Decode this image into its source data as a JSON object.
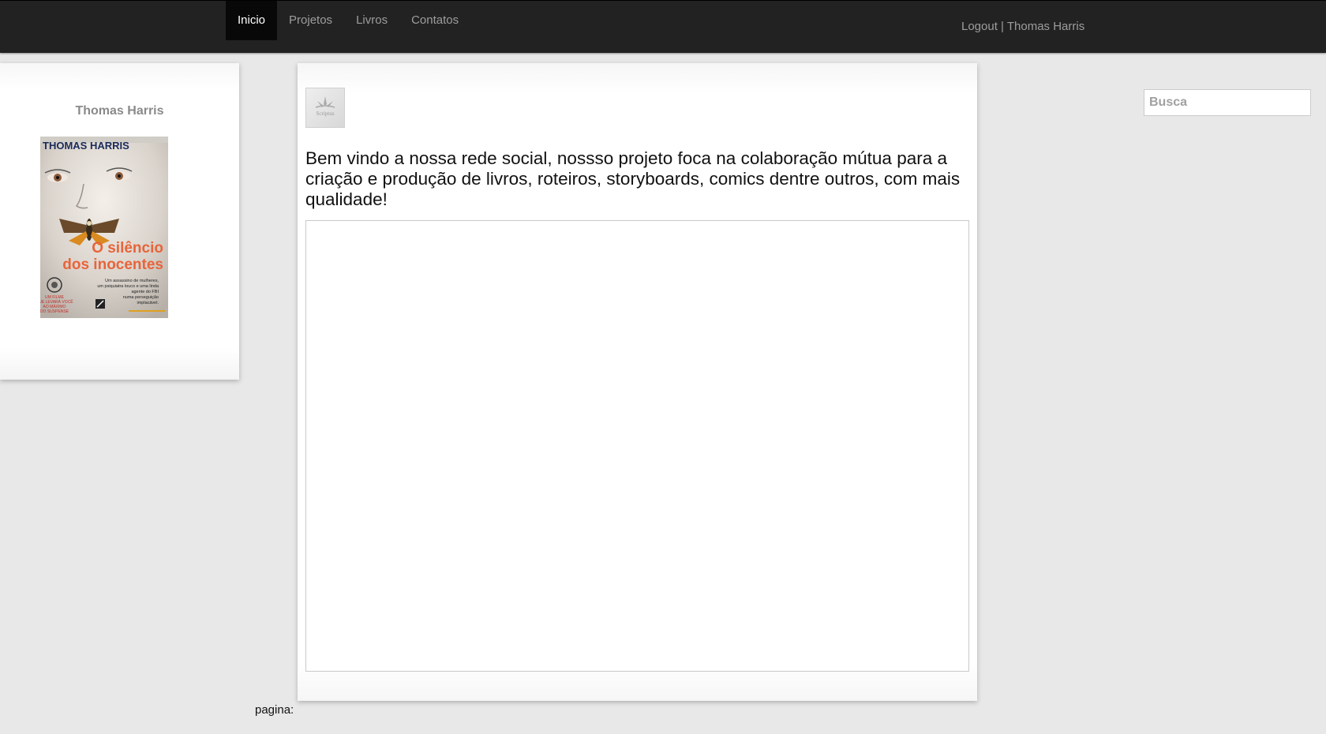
{
  "nav": {
    "items": [
      {
        "label": "Inicio"
      },
      {
        "label": "Projetos"
      },
      {
        "label": "Livros"
      },
      {
        "label": "Contatos"
      }
    ]
  },
  "user": {
    "logout_label": "Logout",
    "separator": " | ",
    "name": "Thomas Harris"
  },
  "profile": {
    "name": "Thomas Harris",
    "book_cover": {
      "author": "THOMAS HARRIS",
      "title_line1": "O silêncio",
      "title_line2": "dos inocentes",
      "blurb": "Um assassino de mulheres, um psiquiatra louco e uma linda agente do FBI numa perseguição implacável.",
      "tagline": "UM FILME QUE LEVARÁ VOCÊ AO MÁXIMO DO SUSPENSE"
    }
  },
  "main": {
    "logo_text": "Scriptus",
    "welcome": "Bem vindo a nossa rede social, nossso projeto foca na colaboração mútua para a criação e produção de livros, roteiros, storyboards, comics dentre outros, com mais qualidade!"
  },
  "footer": {
    "page_label": "pagina:"
  },
  "search": {
    "placeholder": "Busca",
    "value": ""
  },
  "colors": {
    "topbar": "#222222",
    "active_nav": "#080808",
    "nav_text": "#9d9d9d",
    "background": "#e8e8e8"
  }
}
